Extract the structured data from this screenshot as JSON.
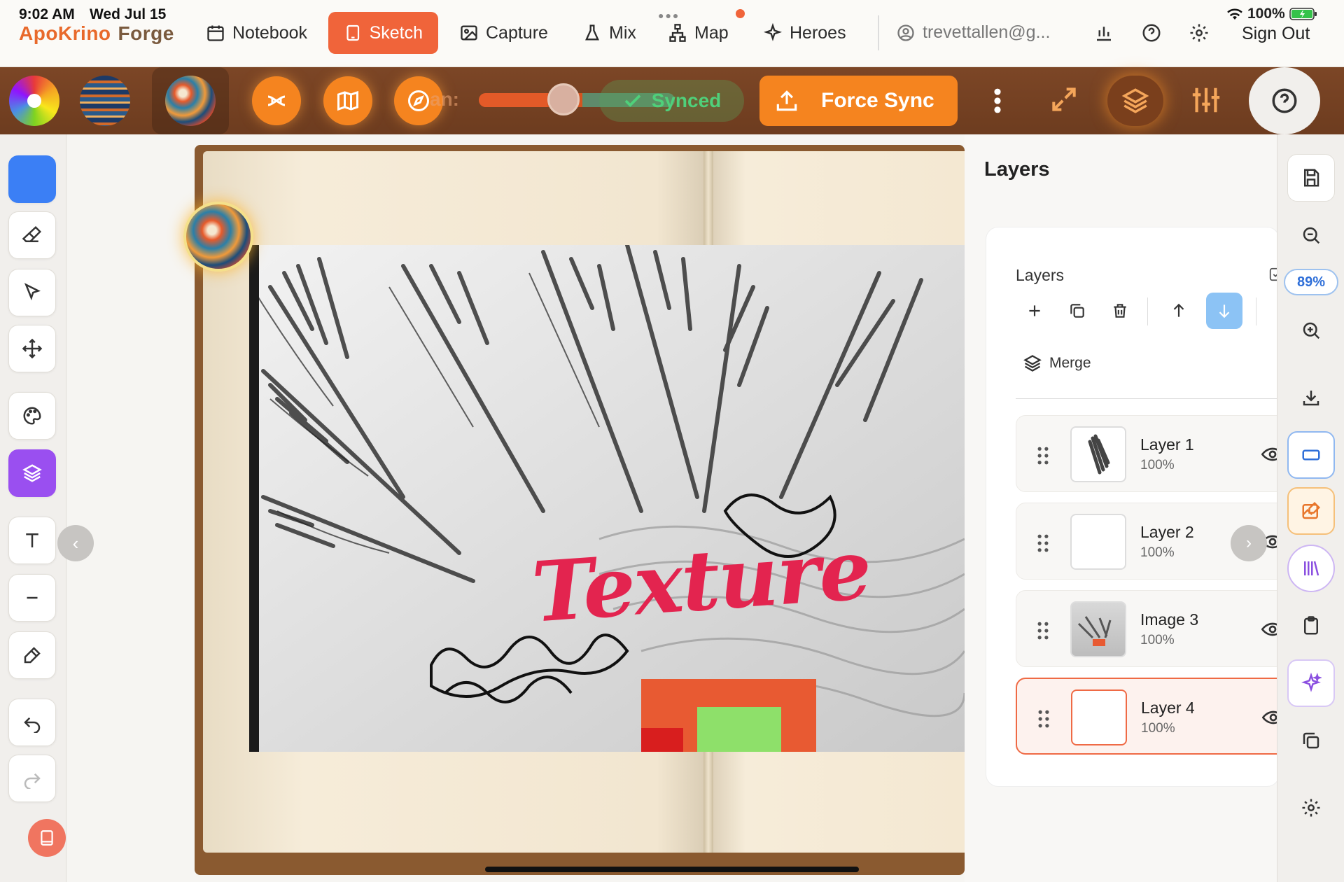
{
  "status": {
    "time": "9:02 AM",
    "date": "Wed Jul 15",
    "battery": "100%"
  },
  "brand": {
    "part1": "ApoKrino",
    "part2": "Forge"
  },
  "nav": {
    "tabs": [
      {
        "label": "Notebook",
        "icon": "calendar-icon"
      },
      {
        "label": "Sketch",
        "icon": "tablet-icon",
        "active": true
      },
      {
        "label": "Capture",
        "icon": "image-icon"
      },
      {
        "label": "Mix",
        "icon": "flask-icon"
      },
      {
        "label": "Map",
        "icon": "sitemap-icon"
      },
      {
        "label": "Heroes",
        "icon": "sparkle-icon"
      }
    ],
    "account": "trevettallen@g...",
    "sign_out": "Sign Out"
  },
  "toolstrip": {
    "slider_label": "an:",
    "slider_value": 0.35,
    "synced_label": "Synced",
    "force_sync_label": "Force Sync"
  },
  "canvas": {
    "overlay_text": "Texture"
  },
  "layers": {
    "title": "Layers",
    "card_title": "Layers",
    "merge_label": "Merge",
    "items": [
      {
        "name": "Layer 1",
        "opacity": "100%",
        "selected": false
      },
      {
        "name": "Layer 2",
        "opacity": "100%",
        "selected": false
      },
      {
        "name": "Image 3",
        "opacity": "100%",
        "selected": false
      },
      {
        "name": "Layer 4",
        "opacity": "100%",
        "selected": true
      }
    ]
  },
  "zoom": {
    "level": "89%"
  },
  "colors": {
    "accent": "#f0643a",
    "toolbar_brown": "#7c4626",
    "orange": "#f5841f",
    "current_color": "#3b7ff5",
    "text_red": "#e3244f"
  }
}
